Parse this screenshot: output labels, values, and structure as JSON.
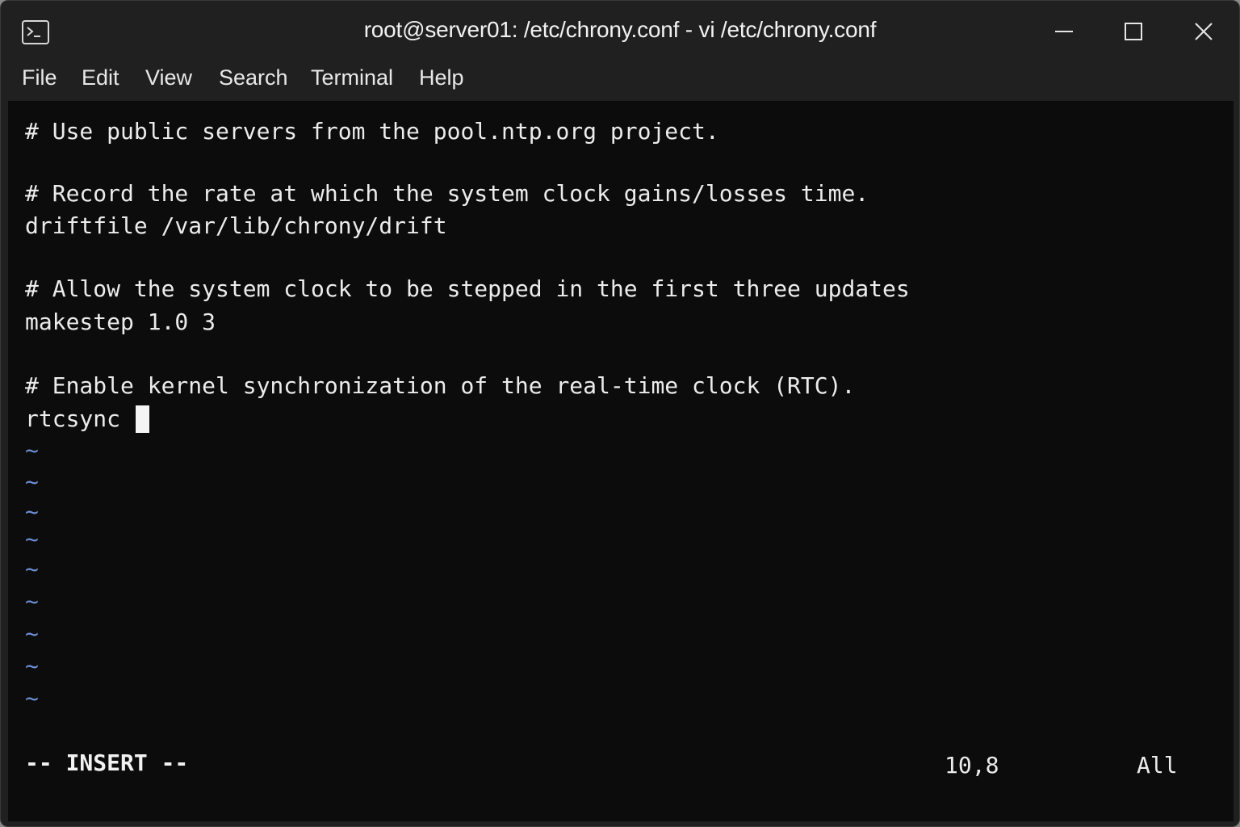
{
  "window": {
    "title": "root@server01: /etc/chrony.conf - vi /etc/chrony.conf",
    "icon": "terminal-icon"
  },
  "menu": {
    "items": [
      "File",
      "Edit",
      "View",
      "Search",
      "Terminal",
      "Help"
    ]
  },
  "editor": {
    "lines": [
      "# Use public servers from the pool.ntp.org project.",
      "",
      "# Record the rate at which the system clock gains/losses time.",
      "driftfile /var/lib/chrony/drift",
      "",
      "# Allow the system clock to be stepped in the first three updates",
      "makestep 1.0 3",
      "",
      "# Enable kernel synchronization of the real-time clock (RTC).",
      "rtcsync "
    ],
    "empty_line_marker": "~",
    "empty_line_count": 9
  },
  "status": {
    "mode": "-- INSERT --",
    "position": "10,8",
    "scroll": "All"
  },
  "colors": {
    "background": "#0c0c0c",
    "titlebar": "#202020",
    "text": "#ececec",
    "tilde": "#6f8fd8"
  }
}
